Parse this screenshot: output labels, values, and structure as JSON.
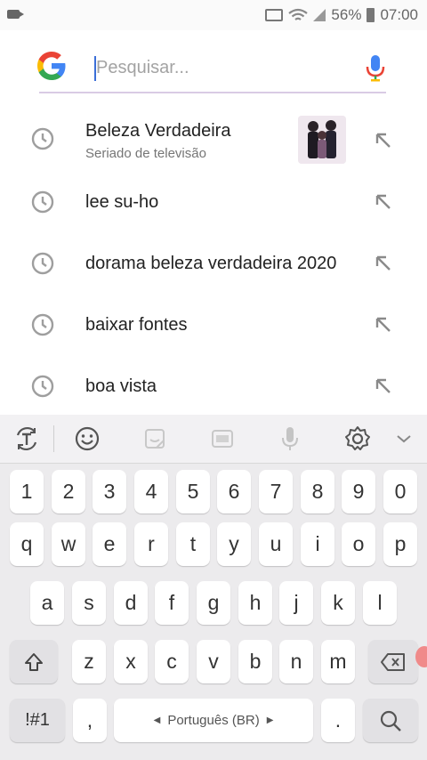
{
  "status_bar": {
    "battery": "56%",
    "time": "07:00"
  },
  "search": {
    "placeholder": "Pesquisar..."
  },
  "suggestions": [
    {
      "title": "Beleza Verdadeira",
      "subtitle": "Seriado de televisão",
      "has_thumbnail": true
    },
    {
      "title": "lee su-ho"
    },
    {
      "title": "dorama beleza verdadeira 2020"
    },
    {
      "title": "baixar fontes"
    },
    {
      "title": "boa vista"
    }
  ],
  "keyboard": {
    "toolbar_icons": [
      "text-mode-icon",
      "emoji-icon",
      "sticker-icon",
      "gif-icon",
      "voice-input-icon",
      "settings-icon",
      "collapse-icon"
    ],
    "row_numbers": [
      "1",
      "2",
      "3",
      "4",
      "5",
      "6",
      "7",
      "8",
      "9",
      "0"
    ],
    "row_top": [
      "q",
      "w",
      "e",
      "r",
      "t",
      "y",
      "u",
      "i",
      "o",
      "p"
    ],
    "row_home": [
      "a",
      "s",
      "d",
      "f",
      "g",
      "h",
      "j",
      "k",
      "l"
    ],
    "row_bottom": [
      "z",
      "x",
      "c",
      "v",
      "b",
      "n",
      "m"
    ],
    "symbols_label": "!#1",
    "comma_label": ",",
    "space_label": "Português (BR)",
    "period_label": "."
  },
  "colors": {
    "accent": "#3b6fd8",
    "keyboard_bg": "#ecebed"
  }
}
